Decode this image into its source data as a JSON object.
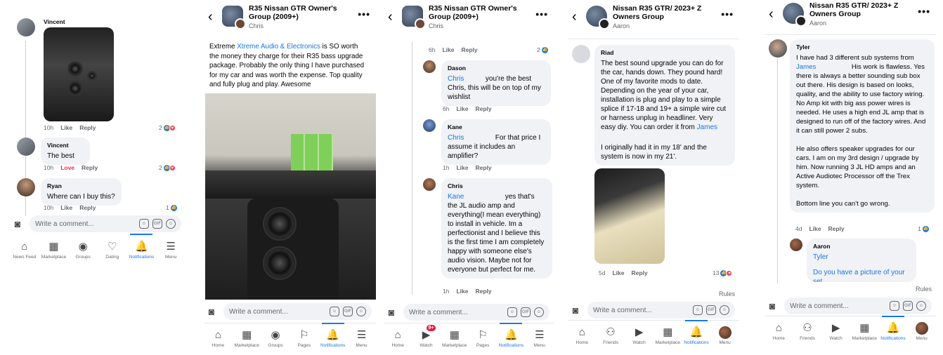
{
  "p1": {
    "comments": [
      {
        "name": "Vincent",
        "text": "",
        "time": "10h",
        "like": "Like",
        "reply": "Reply",
        "count": "2"
      },
      {
        "name": "Vincent",
        "text": "The best",
        "time": "10h",
        "like": "Love",
        "reply": "Reply",
        "count": "2"
      },
      {
        "name": "Ryan",
        "text": "Where can I buy this?",
        "time": "10h",
        "like": "Like",
        "reply": "Reply",
        "count": "1"
      }
    ],
    "compose_placeholder": "Write a comment...",
    "gif": "GIF",
    "nav": [
      "News Feed",
      "Marketplace",
      "Groups",
      "Dating",
      "Notifications",
      "Menu"
    ]
  },
  "p2": {
    "title": "R35 Nissan GTR Owner's Group (2009+)",
    "subtitle": "Chris",
    "text_pre": "Extreme ",
    "text_link": "Xtreme Audio & Electronics",
    "text_post": " is SO worth the money they charge for their R35 bass upgrade package. Probably the only thing I have purchased for my car and was worth the expense. Top quality and fully plug and play. Awesome",
    "compose_placeholder": "Write a comment...",
    "gif": "GIF",
    "nav": [
      "Home",
      "Marketplace",
      "Groups",
      "Pages",
      "Notifications",
      "Menu"
    ]
  },
  "p3": {
    "title": "R35 Nissan GTR Owner's Group (2009+)",
    "subtitle": "Chris",
    "top_meta": {
      "time": "6h",
      "like": "Like",
      "reply": "Reply",
      "count": "2"
    },
    "comments": [
      {
        "name": "Dason",
        "mention": "Chris",
        "text": "you're the best Chris, this will be on top of my wishlist",
        "time": "6h",
        "like": "Like",
        "reply": "Reply"
      },
      {
        "name": "Kane",
        "mention": "Chris",
        "text": "For that price I assume it includes an amplifier?",
        "time": "1h",
        "like": "Like",
        "reply": "Reply"
      },
      {
        "name": "Chris",
        "mention": "Kane",
        "text": "yes that's the JL audio amp and everything(I mean everything) to install in vehicle. Im a perfectionist and I believe this is the first time I am completely happy with someone else's audio vision. Maybe not for everyone but perfect for me.",
        "time": "1h",
        "like": "Like",
        "reply": "Reply"
      }
    ],
    "compose_placeholder": "Write a comment...",
    "gif": "GIF",
    "badge": "9+",
    "nav": [
      "Home",
      "Watch",
      "Marketplace",
      "Pages",
      "Notifications",
      "Menu"
    ]
  },
  "p4": {
    "title": "Nissan R35 GTR/ 2023+ Z Owners Group",
    "subtitle": "Aaron",
    "comment": {
      "name": "Riad",
      "text1": "The best sound upgrade you can do for the car, hands down. They pound hard! One of my favorite mods to date. Depending on the year of your car, installation is plug and play to a simple splice if 17-18 and 19+ a simple wire cut or harness unplug in headliner. Very easy diy. You can order it from ",
      "link": "James",
      "text2": "I originally had it in my 18' and the system is now in my 21'.",
      "time": "5d",
      "like": "Like",
      "reply": "Reply",
      "count": "13"
    },
    "rules": "Rules",
    "compose_placeholder": "Write a comment...",
    "gif": "GIF",
    "nav": [
      "Home",
      "Friends",
      "Watch",
      "Marketplace",
      "Notifications",
      "Menu"
    ]
  },
  "p5": {
    "title": "Nissan R35 GTR/ 2023+ Z Owners Group",
    "subtitle": "Aaron",
    "comment": {
      "name": "Tyler",
      "text_pre": "I have had 3 different sub systems from",
      "link": "James",
      "text1": "His work is flawless.  Yes there is always a better sounding sub box out there.  His design is based on looks, quality, and the ability to use factory wiring.  No Amp kit with big ass power wires is needed.  He uses a high end JL amp that is designed to run off of the factory wires.  And it can still power 2 subs.",
      "text2": "He also offers speaker upgrades for our cars.   I am on my 3rd design / upgrade by him.  Now running 3 JL HD amps and an Active Audiotec Processor off the Trex system.",
      "text3": "Bottom line you can't go wrong.",
      "time": "4d",
      "like": "Like",
      "reply": "Reply",
      "count": "1"
    },
    "reply": {
      "name": "Aaron",
      "mention": "Tyler",
      "text": "Do you have a picture of your set"
    },
    "rules": "Rules",
    "compose_placeholder": "Write a comment...",
    "gif": "GIF",
    "nav": [
      "Home",
      "Friends",
      "Watch",
      "Marketplace",
      "Notifications",
      "Menu"
    ]
  }
}
